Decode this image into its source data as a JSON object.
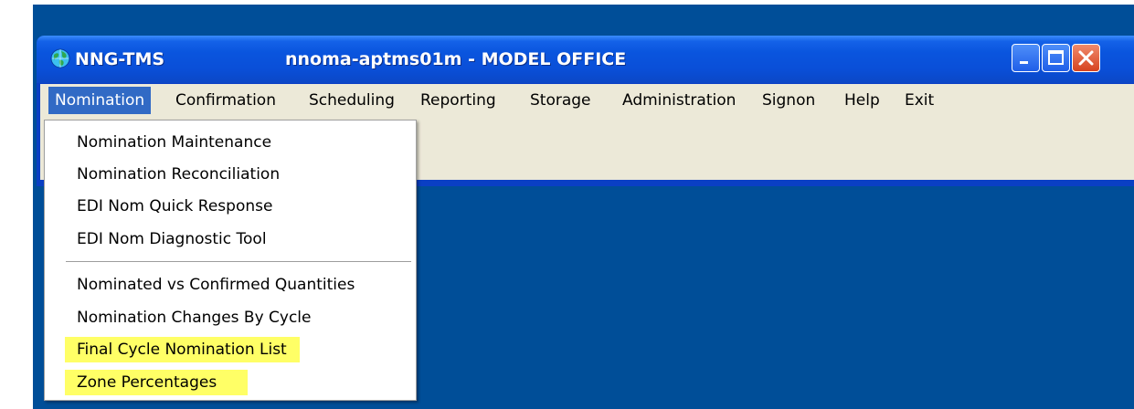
{
  "window": {
    "app_title": "NNG-TMS",
    "server_title": "nnoma-aptms01m - MODEL OFFICE"
  },
  "menubar": {
    "items": [
      {
        "label": "Nomination",
        "active": true
      },
      {
        "label": "Confirmation"
      },
      {
        "label": "Scheduling"
      },
      {
        "label": "Reporting"
      },
      {
        "label": "Storage"
      },
      {
        "label": "Administration"
      },
      {
        "label": "Signon"
      },
      {
        "label": "Help"
      },
      {
        "label": "Exit"
      }
    ]
  },
  "dropdown": {
    "group1": [
      "Nomination Maintenance",
      "Nomination Reconciliation",
      "EDI Nom Quick Response",
      "EDI Nom Diagnostic Tool"
    ],
    "group2": [
      "Nominated vs Confirmed Quantities",
      "Nomination Changes By Cycle",
      "Final Cycle Nomination List",
      "Zone Percentages"
    ],
    "highlighted": [
      "Final Cycle Nomination List",
      "Zone Percentages"
    ]
  },
  "colors": {
    "desktop": "#004e98",
    "titlebar": "#0a55de",
    "menubar": "#ece9d8",
    "menu_active": "#316ac5",
    "highlight": "#ffff66"
  },
  "icons": {
    "app": "globe-icon",
    "minimize": "minimize-icon",
    "maximize": "maximize-icon",
    "close": "close-icon"
  }
}
